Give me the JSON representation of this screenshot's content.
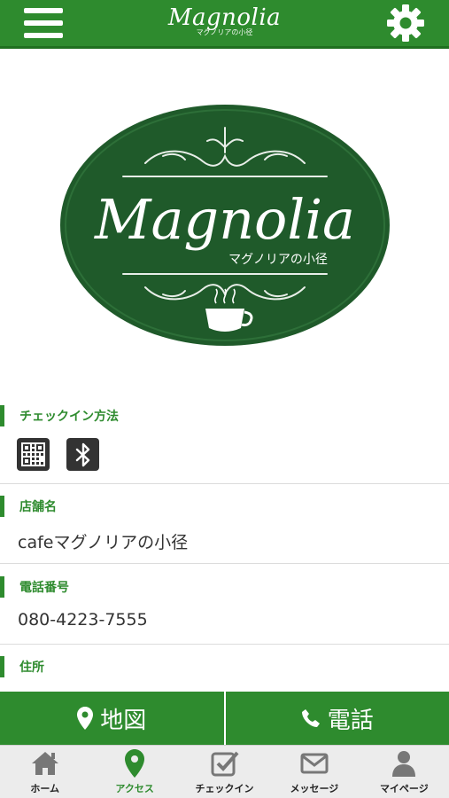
{
  "header": {
    "logo_script": "Magnolia",
    "logo_sub": "マグノリアの小径"
  },
  "hero": {
    "logo_script": "Magnolia",
    "logo_sub": "マグノリアの小径"
  },
  "checkin": {
    "label": "チェックイン方法"
  },
  "store": {
    "label": "店舗名",
    "value": "cafeマグノリアの小径"
  },
  "phone": {
    "label": "電話番号",
    "value": "080-4223-7555"
  },
  "address": {
    "label": "住所"
  },
  "actions": {
    "map_label": "地図",
    "call_label": "電話"
  },
  "tabs": [
    {
      "label": "ホーム"
    },
    {
      "label": "アクセス"
    },
    {
      "label": "チェックイン"
    },
    {
      "label": "メッセージ"
    },
    {
      "label": "マイページ"
    }
  ],
  "colors": {
    "brand_green": "#2e8b2e",
    "logo_green": "#1f5a2a"
  }
}
